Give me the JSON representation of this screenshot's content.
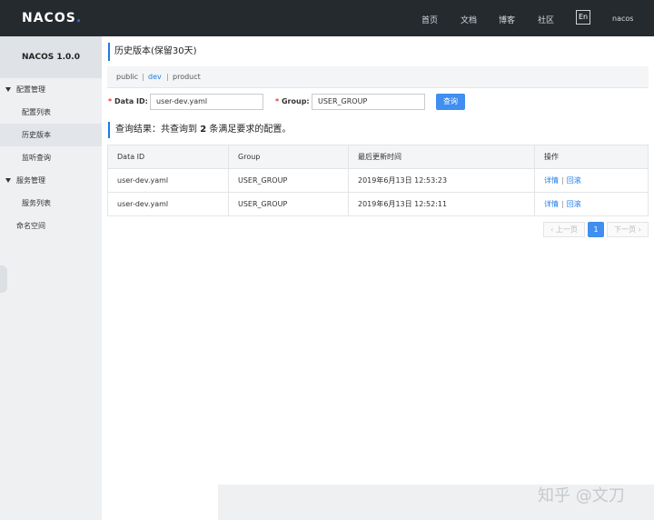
{
  "header": {
    "logo": "NACOS",
    "logo_dot": ".",
    "nav": [
      "首页",
      "文档",
      "博客",
      "社区"
    ],
    "lang": "En",
    "user": "nacos"
  },
  "sidebar": {
    "title": "NACOS 1.0.0",
    "items": [
      {
        "label": "配置管理",
        "type": "group"
      },
      {
        "label": "配置列表",
        "type": "sub"
      },
      {
        "label": "历史版本",
        "type": "sub",
        "active": true
      },
      {
        "label": "监听查询",
        "type": "sub"
      },
      {
        "label": "服务管理",
        "type": "group"
      },
      {
        "label": "服务列表",
        "type": "sub"
      },
      {
        "label": "命名空间",
        "type": "plain"
      }
    ]
  },
  "main": {
    "title": "历史版本(保留30天)",
    "namespaces": [
      "public",
      "dev",
      "product"
    ],
    "active_namespace": "dev",
    "form": {
      "data_id_label": "Data ID:",
      "data_id_value": "user-dev.yaml",
      "group_label": "Group:",
      "group_value": "USER_GROUP",
      "query_button": "查询"
    },
    "result": {
      "prefix": "查询结果：共查询到",
      "count": "2",
      "suffix": "条满足要求的配置。"
    },
    "table": {
      "columns": [
        "Data ID",
        "Group",
        "最后更新时间",
        "操作"
      ],
      "rows": [
        {
          "data_id": "user-dev.yaml",
          "group": "USER_GROUP",
          "time": "2019年6月13日 12:53:23"
        },
        {
          "data_id": "user-dev.yaml",
          "group": "USER_GROUP",
          "time": "2019年6月13日 12:52:11"
        }
      ],
      "action_detail": "详情",
      "action_sep": "|",
      "action_rollback": "回滚"
    },
    "pager": {
      "prev": "上一页",
      "current": "1",
      "next": "下一页"
    }
  },
  "watermark": "知乎 @文刀",
  "colors": {
    "topbar": "#252a2f",
    "accent": "#1e7be6",
    "button": "#3f8ef0"
  }
}
